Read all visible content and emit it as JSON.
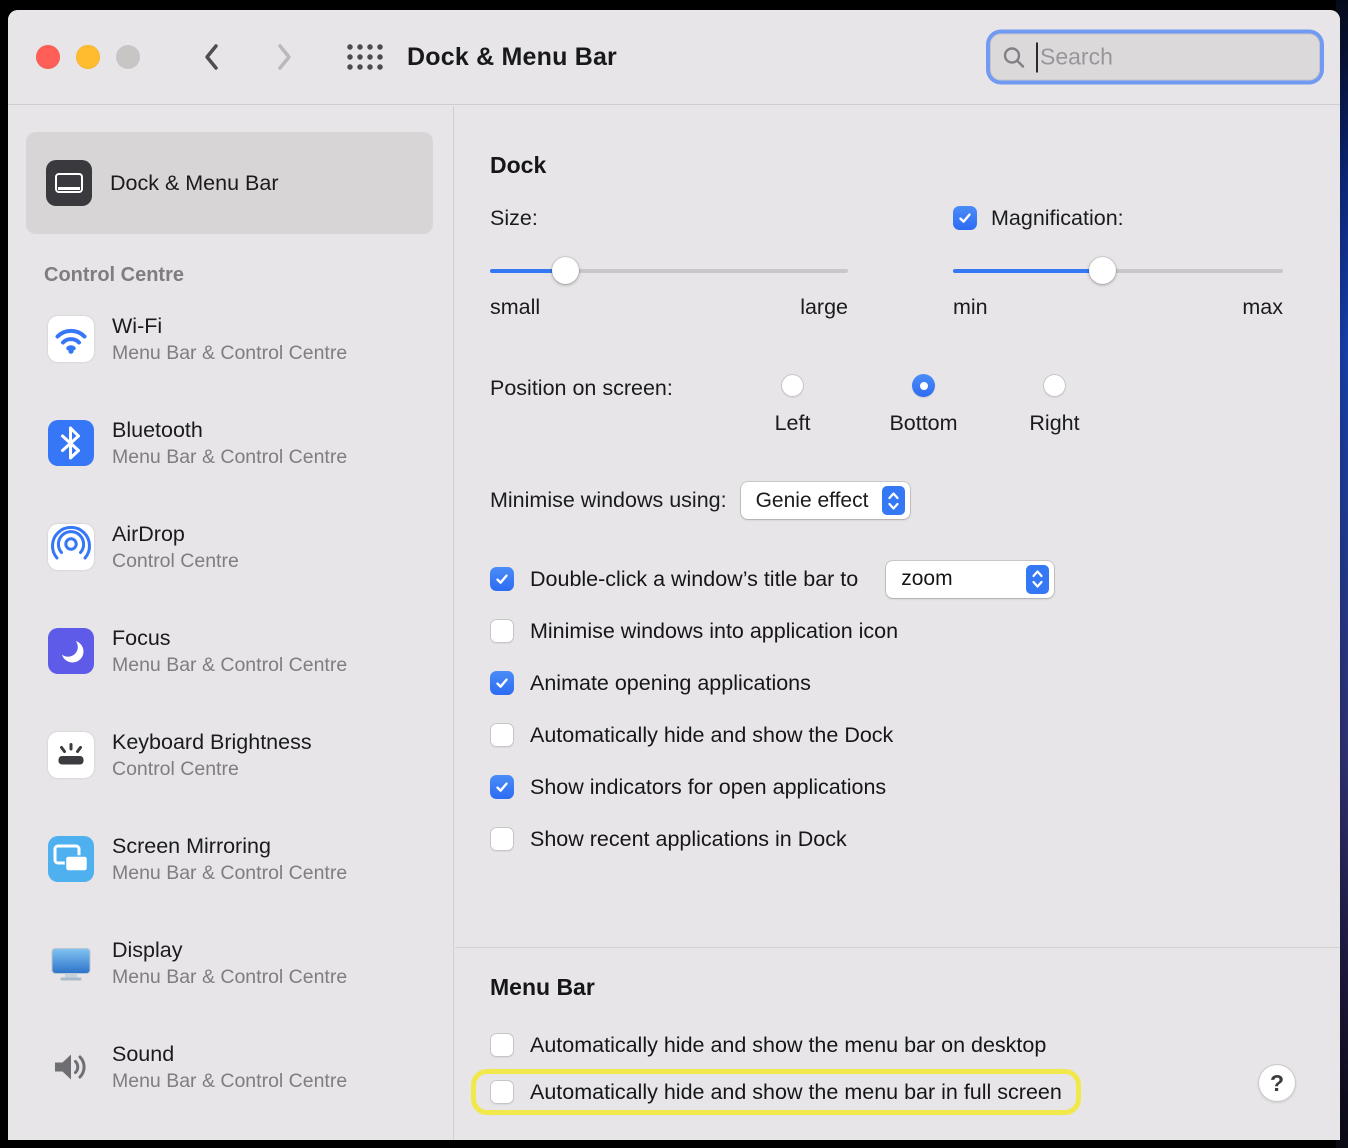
{
  "window": {
    "title": "Dock & Menu Bar",
    "search_placeholder": "Search"
  },
  "sidebar": {
    "selected_item": {
      "label": "Dock & Menu Bar",
      "icon": "dock-menu-bar-icon"
    },
    "section_header": "Control Centre",
    "items": [
      {
        "label": "Wi-Fi",
        "subtitle": "Menu Bar & Control Centre",
        "icon": "wifi-icon"
      },
      {
        "label": "Bluetooth",
        "subtitle": "Menu Bar & Control Centre",
        "icon": "bluetooth-icon"
      },
      {
        "label": "AirDrop",
        "subtitle": "Control Centre",
        "icon": "airdrop-icon"
      },
      {
        "label": "Focus",
        "subtitle": "Menu Bar & Control Centre",
        "icon": "focus-icon"
      },
      {
        "label": "Keyboard Brightness",
        "subtitle": "Control Centre",
        "icon": "keyboard-brightness-icon"
      },
      {
        "label": "Screen Mirroring",
        "subtitle": "Menu Bar & Control Centre",
        "icon": "screen-mirroring-icon"
      },
      {
        "label": "Display",
        "subtitle": "Menu Bar & Control Centre",
        "icon": "display-icon"
      },
      {
        "label": "Sound",
        "subtitle": "Menu Bar & Control Centre",
        "icon": "sound-icon"
      }
    ]
  },
  "dock_section": {
    "heading": "Dock",
    "size": {
      "label": "Size:",
      "min_label": "small",
      "max_label": "large",
      "value_pct": 21
    },
    "magnification": {
      "label": "Magnification:",
      "checked": true,
      "min_label": "min",
      "max_label": "max",
      "value_pct": 45
    },
    "position": {
      "label": "Position on screen:",
      "options": [
        "Left",
        "Bottom",
        "Right"
      ],
      "selected": "Bottom"
    },
    "minimise_using": {
      "label": "Minimise windows using:",
      "value": "Genie effect"
    },
    "checkboxes": [
      {
        "label": "Double-click a window’s title bar to",
        "checked": true,
        "dropdown_value": "zoom"
      },
      {
        "label": "Minimise windows into application icon",
        "checked": false
      },
      {
        "label": "Animate opening applications",
        "checked": true
      },
      {
        "label": "Automatically hide and show the Dock",
        "checked": false
      },
      {
        "label": "Show indicators for open applications",
        "checked": true
      },
      {
        "label": "Show recent applications in Dock",
        "checked": false
      }
    ]
  },
  "menu_bar_section": {
    "heading": "Menu Bar",
    "checkboxes": [
      {
        "label": "Automatically hide and show the menu bar on desktop",
        "checked": false,
        "highlighted": false
      },
      {
        "label": "Automatically hide and show the menu bar in full screen",
        "checked": false,
        "highlighted": true
      }
    ],
    "help_label": "?"
  },
  "colors": {
    "accent": "#3478f6",
    "highlight_ring": "#f1e84c",
    "window_background": "#e7e5e7",
    "selected_row": "#d8d5d7"
  }
}
